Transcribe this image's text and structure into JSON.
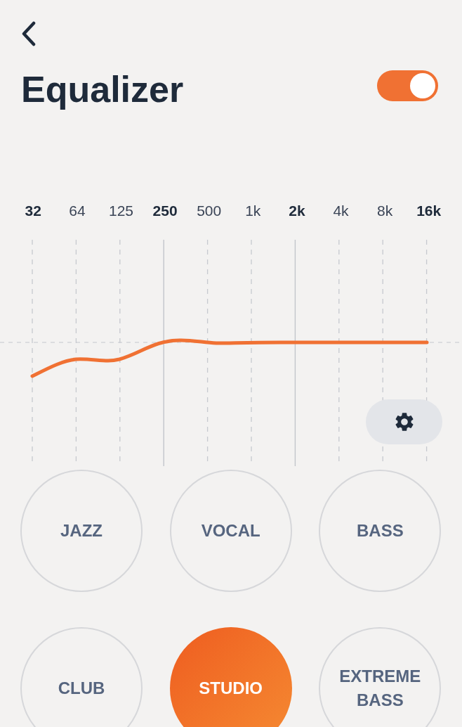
{
  "title": "Equalizer",
  "enabled": true,
  "bands": [
    {
      "label": "32",
      "bold": true,
      "solid": false
    },
    {
      "label": "64",
      "bold": false,
      "solid": false
    },
    {
      "label": "125",
      "bold": false,
      "solid": false
    },
    {
      "label": "250",
      "bold": true,
      "solid": true
    },
    {
      "label": "500",
      "bold": false,
      "solid": false
    },
    {
      "label": "1k",
      "bold": false,
      "solid": false
    },
    {
      "label": "2k",
      "bold": true,
      "solid": true
    },
    {
      "label": "4k",
      "bold": false,
      "solid": false
    },
    {
      "label": "8k",
      "bold": false,
      "solid": false
    },
    {
      "label": "16k",
      "bold": true,
      "solid": false
    }
  ],
  "presets": [
    {
      "label": "JAZZ",
      "selected": false
    },
    {
      "label": "VOCAL",
      "selected": false
    },
    {
      "label": "BASS",
      "selected": false
    },
    {
      "label": "CLUB",
      "selected": false
    },
    {
      "label": "STUDIO",
      "selected": true
    },
    {
      "label": "EXTREME BASS",
      "selected": false
    }
  ]
}
